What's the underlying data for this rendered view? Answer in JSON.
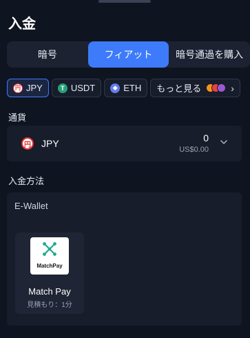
{
  "title": "入金",
  "tabs": [
    {
      "label": "暗号",
      "active": false
    },
    {
      "label": "フィアット",
      "active": true
    },
    {
      "label": "暗号通過を購入",
      "active": false
    }
  ],
  "chips": [
    {
      "label": "JPY",
      "icon": "yen-icon",
      "glyph": "円",
      "active": true
    },
    {
      "label": "USDT",
      "icon": "tether-icon",
      "glyph": "T",
      "active": false
    },
    {
      "label": "ETH",
      "icon": "ethereum-icon",
      "glyph": "◆",
      "active": false
    },
    {
      "label": "もっと見る",
      "icon": "coin-stack-icon",
      "active": false
    }
  ],
  "currency_section_label": "通貨",
  "currency": {
    "code": "JPY",
    "flag_glyph": "円",
    "amount": "0",
    "usd_value": "US$0.00"
  },
  "method_section_label": "入金方法",
  "method_group_label": "E-Wallet",
  "methods": [
    {
      "name": "Match Pay",
      "logo_text": "MatchPay",
      "estimate": "見積もり：1分"
    }
  ],
  "colors": {
    "accent": "#3e7bfa",
    "background": "#0f1421",
    "panel": "#171d2b",
    "matchpay": "#1fa98f"
  }
}
